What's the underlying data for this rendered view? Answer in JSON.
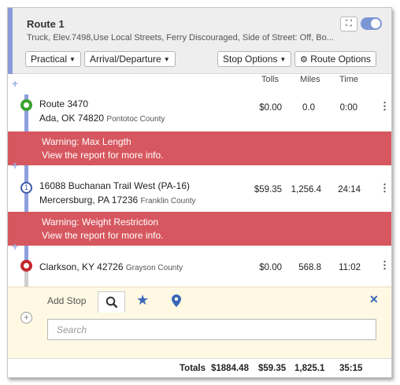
{
  "header": {
    "title": "Route 1",
    "description": "Truck, Elev.7498,Use Local Streets, Ferry Discouraged, Side of Street: Off, Bo...",
    "routing_type": "Practical",
    "timing": "Arrival/Departure",
    "stop_options": "Stop Options",
    "route_options": "Route Options",
    "toggle_on": true
  },
  "columns": {
    "tolls": "Tolls",
    "miles": "Miles",
    "time": "Time"
  },
  "stops": [
    {
      "marker": "",
      "name": "Route 3470",
      "address": "Ada, OK 74820",
      "county": "Pontotoc County",
      "tolls": "$0.00",
      "miles": "0.0",
      "time": "0:00",
      "color": "#3aa22f"
    },
    {
      "marker": "1",
      "name": "16088 Buchanan Trail West (PA-16)",
      "address": "Mercersburg, PA 17236",
      "county": "Franklin County",
      "tolls": "$59.35",
      "miles": "1,256.4",
      "time": "24:14",
      "color": "#3a5aa8"
    },
    {
      "marker": "",
      "name": "Clarkson, KY 42726",
      "address": "",
      "county": "Grayson County",
      "tolls": "$0.00",
      "miles": "568.8",
      "time": "11:02",
      "color": "#c3262d"
    }
  ],
  "warnings": [
    {
      "title": "Warning: Max Length",
      "detail": "View the report for more info."
    },
    {
      "title": "Warning: Weight Restriction",
      "detail": "View the report for more info."
    }
  ],
  "add_stop": {
    "label": "Add Stop",
    "search_placeholder": "Search"
  },
  "totals": {
    "label": "Totals",
    "cost": "$1884.48",
    "tolls": "$59.35",
    "miles": "1,825.1",
    "time": "35:15"
  },
  "colors": {
    "accent": "#8b9ad9",
    "warning": "#d6575f",
    "timeline": "#8ea0de",
    "star": "#3a66b8"
  }
}
